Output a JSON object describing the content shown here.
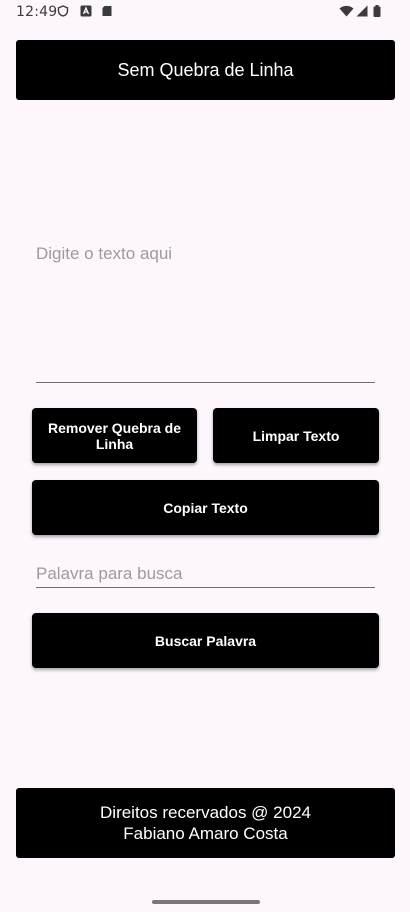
{
  "status_bar": {
    "time": "12:49",
    "left_icons": [
      "shield-icon",
      "font-icon",
      "sd-card-icon"
    ],
    "right_icons": [
      "wifi-icon",
      "signal-icon",
      "battery-icon"
    ]
  },
  "header": {
    "title": "Sem Quebra de Linha"
  },
  "main": {
    "text_area": {
      "placeholder": "Digite o texto aqui",
      "value": ""
    },
    "remove_button_label": "Remover Quebra de Linha",
    "clear_button_label": "Limpar Texto",
    "copy_button_label": "Copiar Texto",
    "search_input": {
      "placeholder": "Palavra para busca",
      "value": ""
    },
    "search_button_label": "Buscar Palavra"
  },
  "footer": {
    "line1": "Direitos recervados @ 2024",
    "line2": "Fabiano Amaro Costa"
  },
  "colors": {
    "background": "#fdf7fd",
    "button": "#000000",
    "button_text": "#ffffff"
  }
}
